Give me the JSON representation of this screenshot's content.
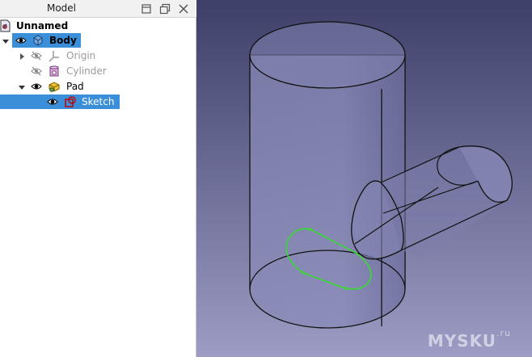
{
  "panel": {
    "title": "Model"
  },
  "tree": {
    "document": "Unnamed",
    "body": "Body",
    "origin": "Origin",
    "cylinder": "Cylinder",
    "pad": "Pad",
    "sketch": "Sketch"
  },
  "viewport": {
    "watermark_main": "MYSKU",
    "watermark_suffix": ".ru"
  },
  "colors": {
    "selection": "#3a8fd8",
    "viewport_top": "#3d3f69",
    "viewport_bottom": "#9c9cc4",
    "sketch": "#3fd23f"
  }
}
